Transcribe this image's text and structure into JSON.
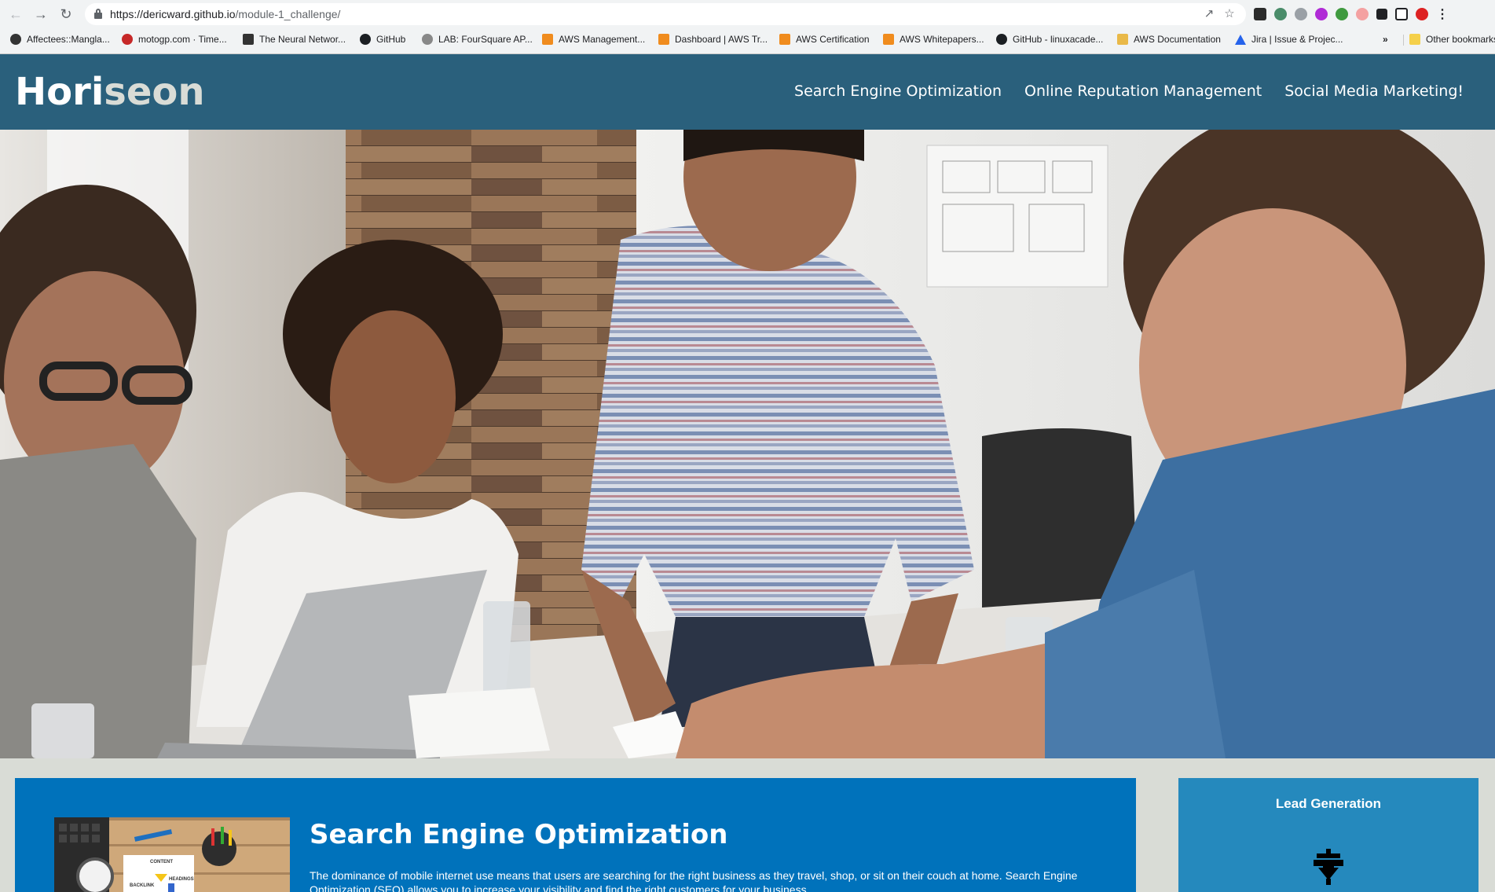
{
  "browser": {
    "url_host": "https://dericward.github.io",
    "url_path": "/module-1_challenge/",
    "bookmarks": [
      {
        "label": "Affectees::Mangla..."
      },
      {
        "label": "motogp.com · Time..."
      },
      {
        "label": "The Neural Networ..."
      },
      {
        "label": "GitHub"
      },
      {
        "label": "LAB: FourSquare AP..."
      },
      {
        "label": "AWS Management..."
      },
      {
        "label": "Dashboard | AWS Tr..."
      },
      {
        "label": "AWS Certification"
      },
      {
        "label": "AWS Whitepapers..."
      },
      {
        "label": "GitHub - linuxacade..."
      },
      {
        "label": "AWS Documentation"
      },
      {
        "label": "Jira | Issue & Projec..."
      },
      {
        "label": "Other bookmarks"
      }
    ],
    "overflow": "»"
  },
  "site": {
    "logo_part1": "Hori",
    "logo_part2": "seon",
    "nav": [
      {
        "label": "Search Engine Optimization"
      },
      {
        "label": "Online Reputation Management"
      },
      {
        "label": "Social Media Marketing!"
      }
    ]
  },
  "main": {
    "section_title": "Search Engine Optimization",
    "section_text": "The dominance of mobile internet use means that users are searching for the right business as they travel, shop, or sit on their couch at home. Search Engine Optimization (SEO) allows you to increase your visibility and find the right customers for your business.",
    "image_labels": {
      "backlink": "BACKLINK",
      "content": "CONTENT",
      "headings": "HEADINGS"
    }
  },
  "aside": {
    "title": "Lead Generation"
  }
}
